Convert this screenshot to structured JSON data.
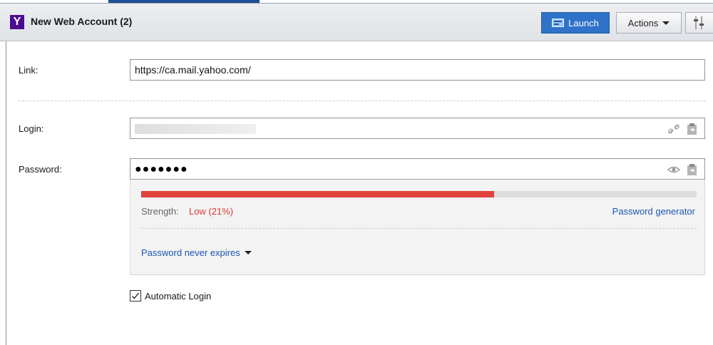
{
  "header": {
    "logo_letter": "Y",
    "title": "New Web Account (2)",
    "launch_label": "Launch",
    "actions_label": "Actions",
    "colors": {
      "launch_bg": "#2f72c9",
      "logo_bg": "#4b0d8f"
    }
  },
  "form": {
    "link": {
      "label": "Link:",
      "value": "https://ca.mail.yahoo.com/"
    },
    "login": {
      "label": "Login:",
      "value": ""
    },
    "password": {
      "label": "Password:",
      "masked": "●●●●●●●"
    }
  },
  "strength": {
    "label": "Strength:",
    "value": "Low (21%)",
    "bar_fraction": 0.635,
    "bar_color": "#e0413c",
    "generator_label": "Password generator"
  },
  "expiry": {
    "label": "Password never expires"
  },
  "auto_login": {
    "label": "Automatic Login",
    "checked": true
  },
  "icons": [
    "logo-y-icon",
    "launch-icon",
    "chevron-down-icon",
    "settings-icon",
    "link-icon",
    "copy-icon",
    "eye-icon",
    "copy-icon",
    "checkmark-icon"
  ]
}
